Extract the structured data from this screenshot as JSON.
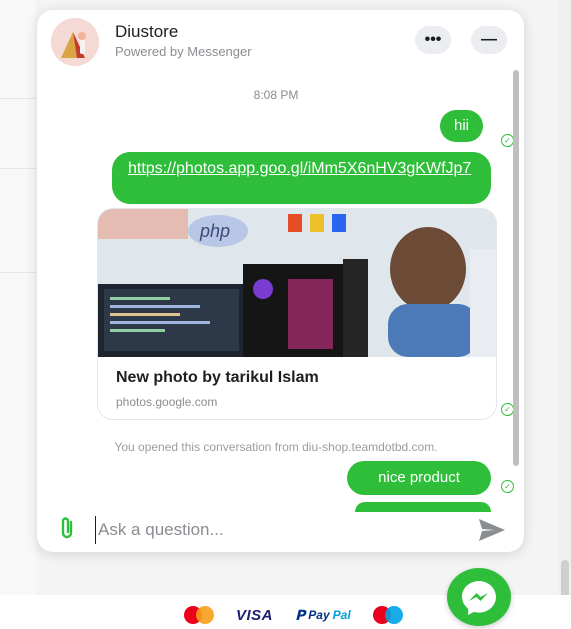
{
  "header": {
    "title": "Diustore",
    "subtitle": "Powered by Messenger",
    "more_label": "•••",
    "minimize_label": "—"
  },
  "messages": {
    "timestamp": "8:08 PM",
    "hii": "hii",
    "link": "https://photos.app.goo.gl/iMm5X6nHV3gKWfJp7",
    "card": {
      "title": "New photo by tarikul Islam",
      "domain": "photos.google.com",
      "image_labels": {
        "php": "php"
      }
    },
    "notice": "You opened this conversation from diu-shop.teamdotbd.com.",
    "nice_product": "nice product"
  },
  "composer": {
    "placeholder": "Ask a question..."
  },
  "payments": {
    "visa": "VISA",
    "paypal_left": "Pay",
    "paypal_right": "Pal"
  },
  "colors": {
    "accent_green": "#2fbe3a",
    "text_primary": "#1c1e21",
    "text_secondary": "#8a8d91"
  },
  "icons": {
    "more": "more-icon",
    "minimize": "minimize-icon",
    "delivered": "check-circle-icon",
    "attach": "paperclip-icon",
    "send": "send-icon",
    "messenger": "messenger-icon"
  }
}
